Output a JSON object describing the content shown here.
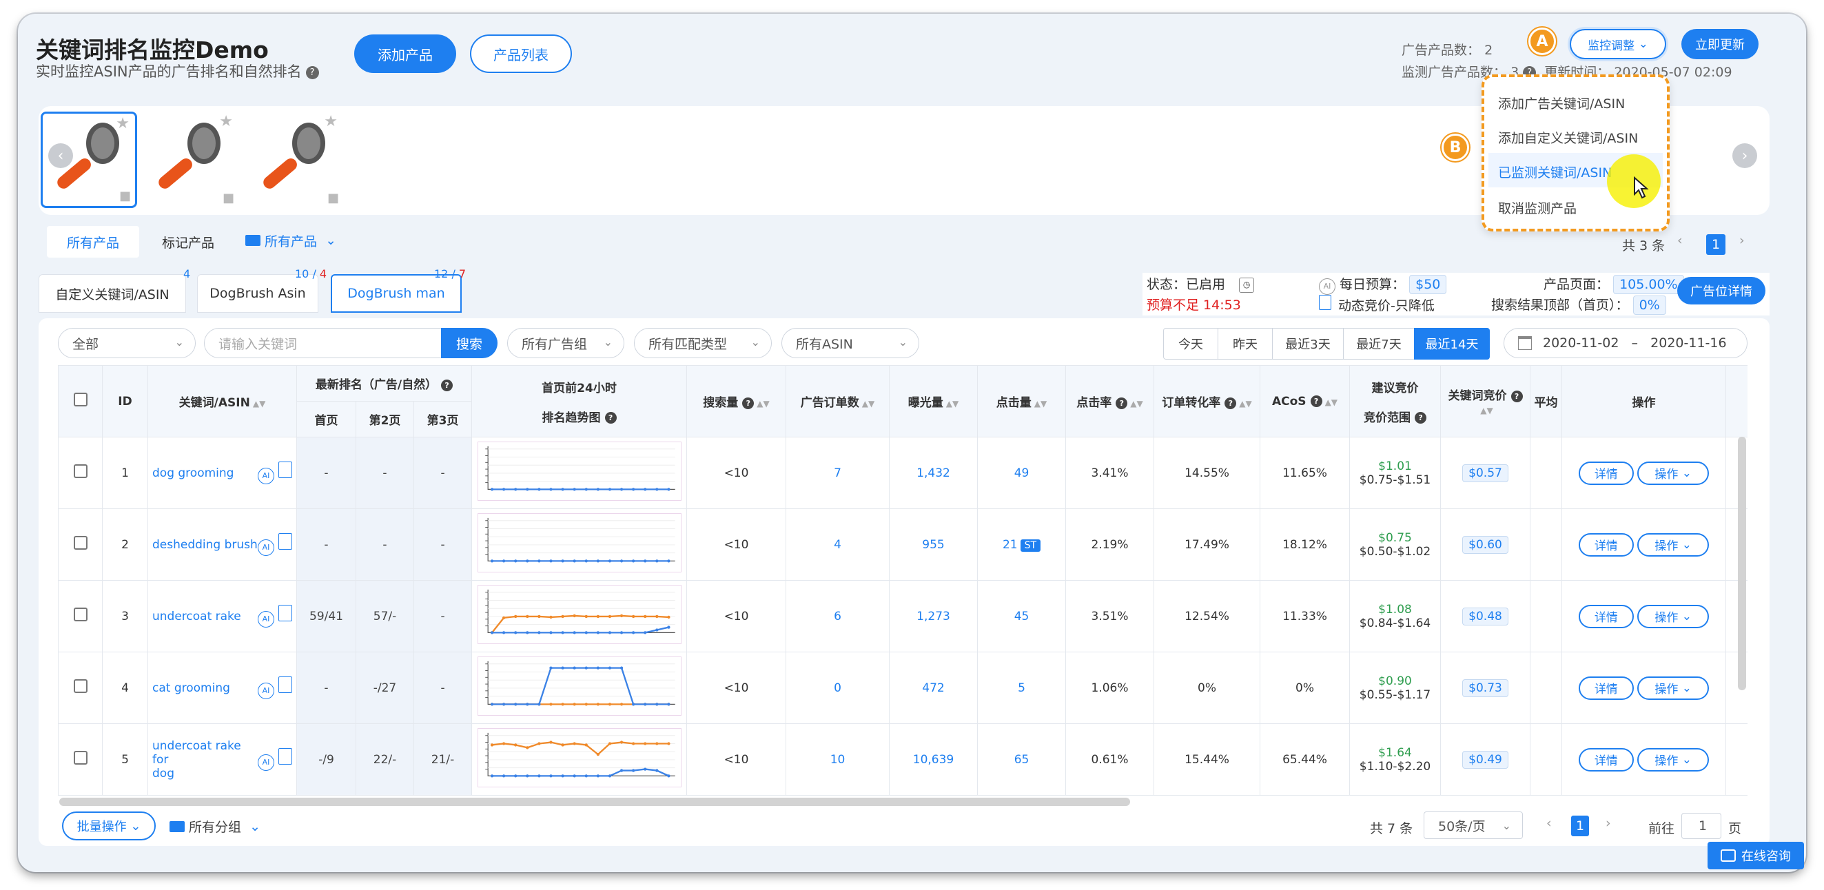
{
  "header": {
    "title": "关键词排名监控Demo",
    "subtitle": "实时监控ASIN产品的广告排名和自然排名",
    "add_product": "添加产品",
    "product_list": "产品列表"
  },
  "stats": {
    "ad_products_label": "广告产品数：",
    "ad_products_value": "2",
    "monitor_ad_label": "监测广告产品数：",
    "monitor_ad_value": "3",
    "update_label": "更新时间：",
    "update_value": "2020-05-07 02:09"
  },
  "actions": {
    "monitor_adjust": "监控调整",
    "update_now": "立即更新"
  },
  "badges": {
    "a": "A",
    "b": "B"
  },
  "dropdown": {
    "items": [
      "添加广告关键词/ASIN",
      "添加自定义关键词/ASIN",
      "已监测关键词/ASIN",
      "取消监测产品"
    ]
  },
  "product_tabs": {
    "all": "所有产品",
    "marked": "标记产品",
    "folder": "所有产品"
  },
  "product_pager": {
    "total": "共 3 条",
    "page": "1"
  },
  "kw_tabs": [
    {
      "label": "自定义关键词/ASIN",
      "count": "4"
    },
    {
      "label": "DogBrush Asin",
      "count_a": "10",
      "count_b": "4"
    },
    {
      "label": "DogBrush man",
      "count_a": "12",
      "count_b": "7"
    }
  ],
  "status": {
    "state_label": "状态：",
    "state_value": "已启用",
    "budget_label": "每日预算：",
    "budget_value": "$50",
    "warn": "预算不足 14:53",
    "dynamic": "动态竞价-只降低",
    "product_page_label": "产品页面：",
    "product_page_value": "105.00%",
    "search_top_label": "搜索结果顶部（首页）：",
    "search_top_value": "0%",
    "placement_btn": "广告位详情"
  },
  "filters": {
    "all": "全部",
    "kw_placeholder": "请输入关键词",
    "search_btn": "搜索",
    "ad_group": "所有广告组",
    "match_type": "所有匹配类型",
    "asin": "所有ASIN"
  },
  "date_ranges": [
    "今天",
    "昨天",
    "最近3天",
    "最近7天",
    "最近14天"
  ],
  "date": {
    "from": "2020-11-02",
    "sep": "–",
    "to": "2020-11-16"
  },
  "table": {
    "headers": {
      "id": "ID",
      "kw": "关键词/ASIN",
      "rank": "最新排名（广告/自然）",
      "p1": "首页",
      "p2": "第2页",
      "p3": "第3页",
      "trend1": "首页前24小时",
      "trend2": "排名趋势图",
      "search": "搜索量",
      "orders": "广告订单数",
      "impr": "曝光量",
      "clicks": "点击量",
      "ctr": "点击率",
      "cvr": "订单转化率",
      "acos": "ACoS",
      "sugg1": "建议竞价",
      "sugg2": "竞价范围",
      "bid": "关键词竞价",
      "avg": "平均",
      "ops": "操作"
    },
    "ai": "AI",
    "rows": [
      {
        "id": "1",
        "kw": "dog grooming",
        "kw2": "",
        "p1": "-",
        "p2": "-",
        "p3": "-",
        "search": "<10",
        "orders": "7",
        "impr": "1,432",
        "clicks": "49",
        "st": "",
        "ctr": "3.41%",
        "cvr": "14.55%",
        "acos": "11.65%",
        "sug": "$1.01",
        "range": "$0.75-$1.51",
        "bid": "$0.57"
      },
      {
        "id": "2",
        "kw": "deshedding brush",
        "kw2": "",
        "p1": "-",
        "p2": "-",
        "p3": "-",
        "search": "<10",
        "orders": "4",
        "impr": "955",
        "clicks": "21",
        "st": "ST",
        "ctr": "2.19%",
        "cvr": "17.49%",
        "acos": "18.12%",
        "sug": "$0.75",
        "range": "$0.50-$1.02",
        "bid": "$0.60"
      },
      {
        "id": "3",
        "kw": "undercoat rake",
        "kw2": "",
        "p1": "59/41",
        "p2": "57/-",
        "p3": "-",
        "search": "<10",
        "orders": "6",
        "impr": "1,273",
        "clicks": "45",
        "st": "",
        "ctr": "3.51%",
        "cvr": "12.54%",
        "acos": "11.33%",
        "sug": "$1.08",
        "range": "$0.84-$1.64",
        "bid": "$0.48"
      },
      {
        "id": "4",
        "kw": "cat grooming",
        "kw2": "",
        "p1": "-",
        "p2": "-/27",
        "p3": "-",
        "search": "<10",
        "orders": "0",
        "impr": "472",
        "clicks": "5",
        "st": "",
        "ctr": "1.06%",
        "cvr": "0%",
        "acos": "0%",
        "sug": "$0.90",
        "range": "$0.55-$1.17",
        "bid": "$0.73"
      },
      {
        "id": "5",
        "kw": "undercoat rake for",
        "kw2": "dog",
        "p1": "-/9",
        "p2": "22/-",
        "p3": "21/-",
        "search": "<10",
        "orders": "10",
        "impr": "10,639",
        "clicks": "65",
        "st": "",
        "ctr": "0.61%",
        "cvr": "15.44%",
        "acos": "65.44%",
        "sug": "$1.64",
        "range": "$1.10-$2.20",
        "bid": "$0.49"
      }
    ],
    "detail_btn": "详情",
    "op_btn": "操作"
  },
  "footer": {
    "bulk": "批量操作",
    "group": "所有分组",
    "total": "共 7 条",
    "per_page": "50条/页",
    "page": "1",
    "goto": "前往",
    "goto_value": "1",
    "page_unit": "页",
    "consult": "在线咨询"
  },
  "colors": {
    "accent": "#1e7ff0",
    "orange": "#f39a1f",
    "warn": "#e02020",
    "green": "#2e9d4e"
  }
}
